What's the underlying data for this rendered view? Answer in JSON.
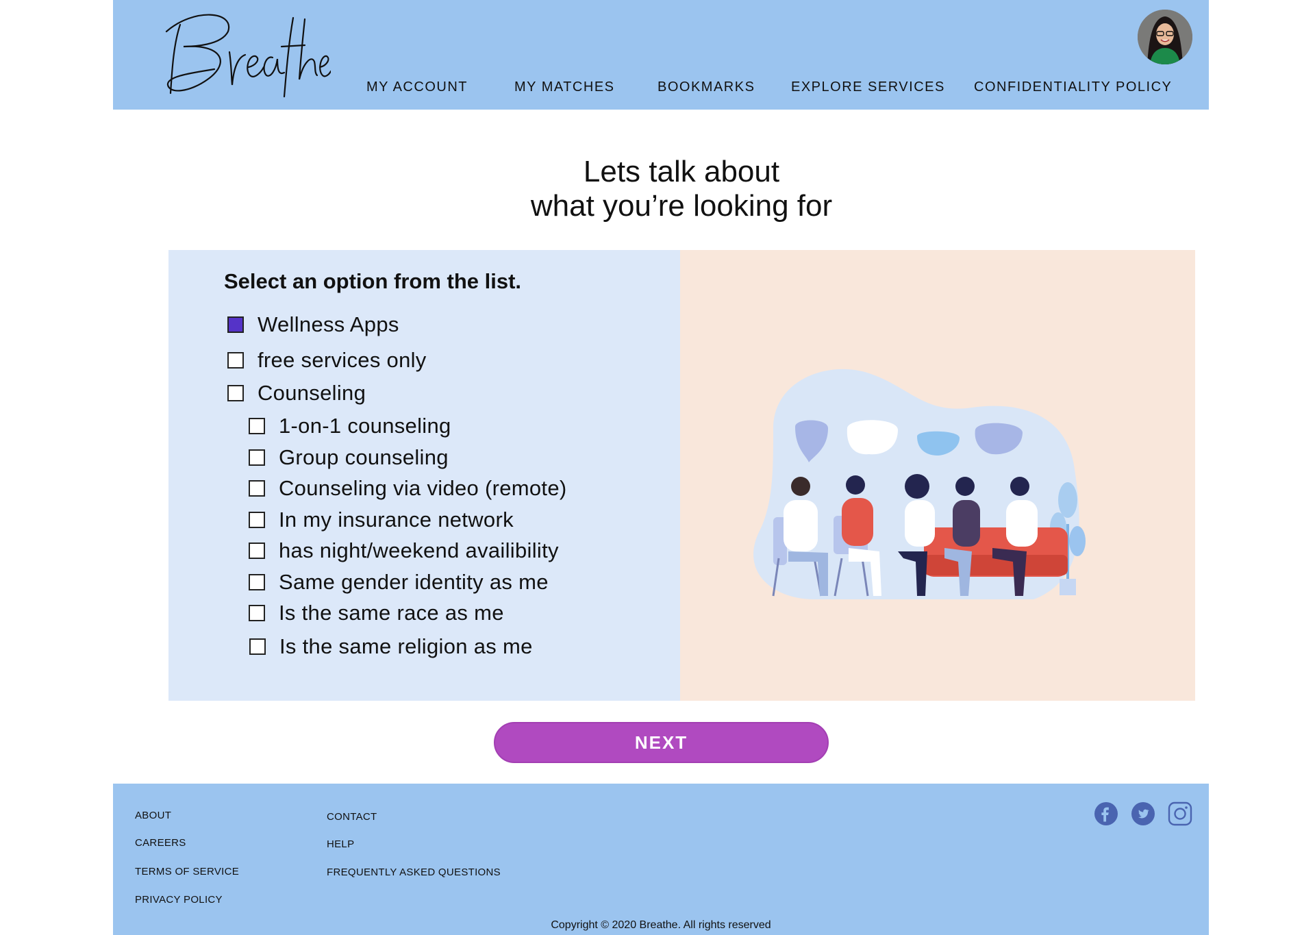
{
  "header": {
    "logo_text": "Breathe",
    "nav": [
      "MY ACCOUNT",
      "MY MATCHES",
      "BOOKMARKS",
      "EXPLORE SERVICES",
      "CONFIDENTIALITY POLICY"
    ]
  },
  "page": {
    "title_line1": "Lets talk about",
    "title_line2": "what you’re looking for"
  },
  "form": {
    "instructions": "Select an option from the list.",
    "options": [
      {
        "label": "Wellness Apps",
        "checked": true
      },
      {
        "label": "free services only",
        "checked": false
      },
      {
        "label": "Counseling",
        "checked": false
      },
      {
        "label": "1-on-1 counseling",
        "checked": false
      },
      {
        "label": "Group counseling",
        "checked": false
      },
      {
        "label": "Counseling via video (remote)",
        "checked": false
      },
      {
        "label": "In my insurance network",
        "checked": false
      },
      {
        "label": "has night/weekend availibility",
        "checked": false
      },
      {
        "label": "Same gender identity as me",
        "checked": false
      },
      {
        "label": "Is the same race as me",
        "checked": false
      },
      {
        "label": "Is the same religion as me",
        "checked": false
      }
    ],
    "next_label": "NEXT"
  },
  "footer": {
    "col1": [
      "ABOUT",
      "CAREERS",
      "TERMS OF SERVICE",
      "PRIVACY POLICY"
    ],
    "col2": [
      "CONTACT",
      "HELP",
      "FREQUENTLY ASKED QUESTIONS"
    ],
    "social_icons": [
      "facebook-icon",
      "twitter-icon",
      "instagram-icon"
    ],
    "copyright": "Copyright © 2020 Breathe. All rights reserved"
  },
  "colors": {
    "header_bg": "#9bc4ef",
    "left_panel_bg": "#dce8f9",
    "right_panel_bg": "#f9e7db",
    "checked_box": "#5533c8",
    "next_button": "#b04ac0"
  }
}
